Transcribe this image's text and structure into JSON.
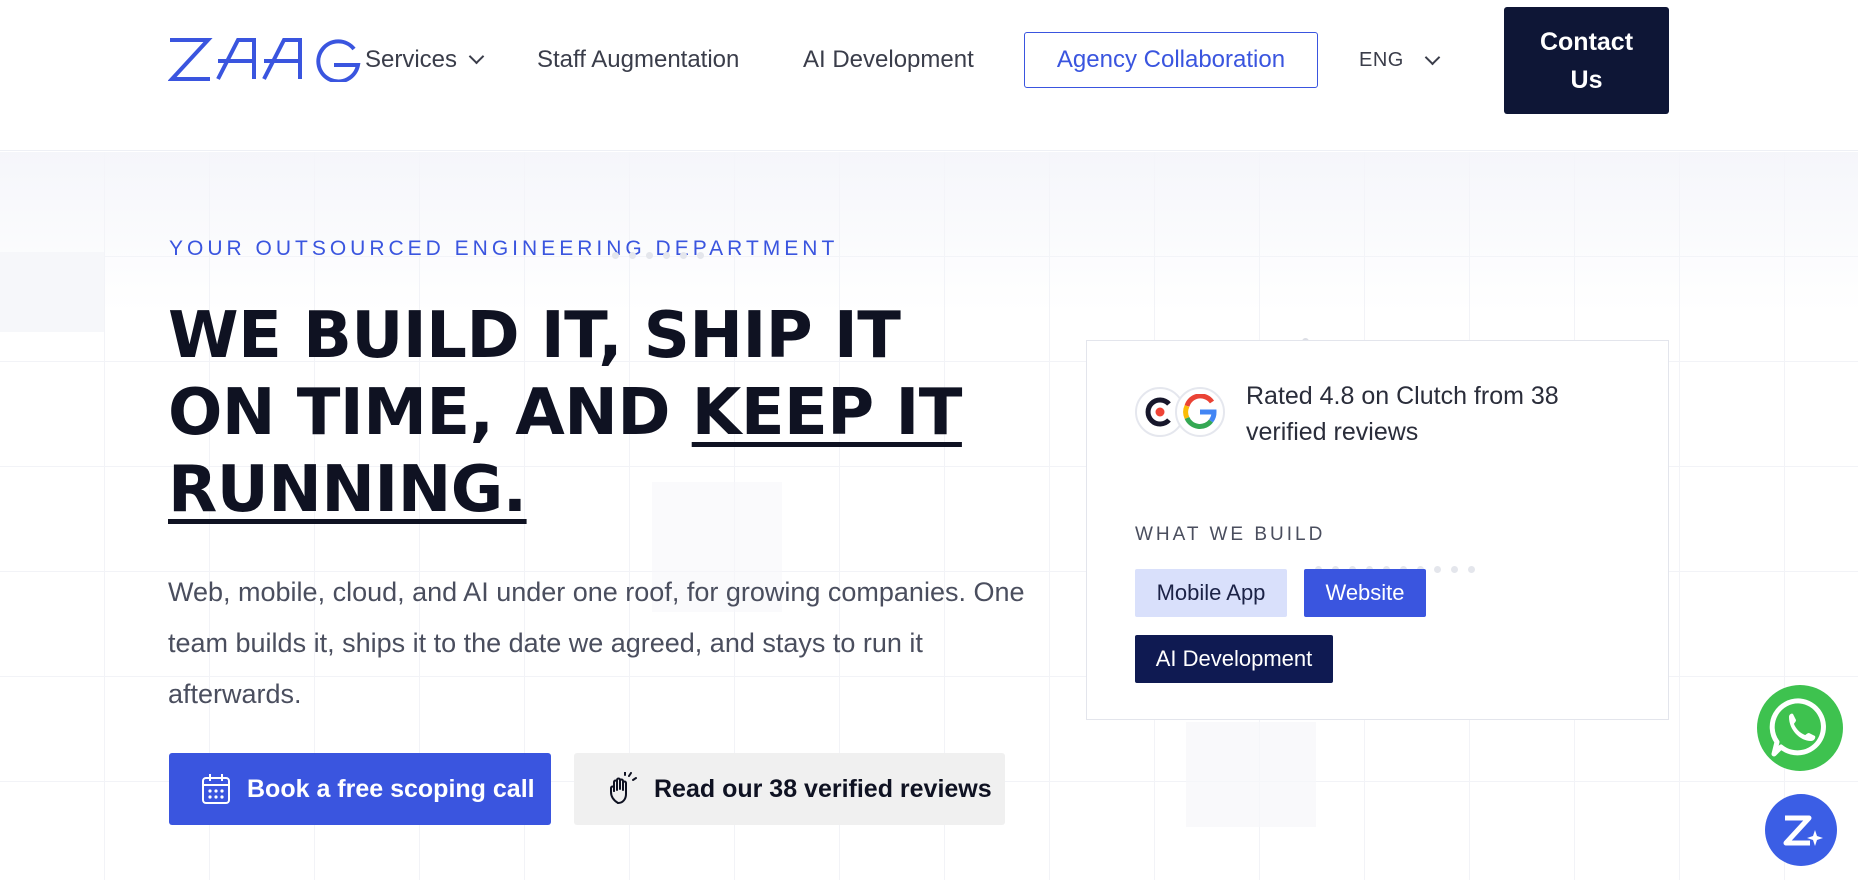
{
  "brand": {
    "logo_text": "ZAAG",
    "accent": "#3a55df",
    "dark": "#0e1636"
  },
  "header": {
    "nav": {
      "services": "Services",
      "staff": "Staff Augmentation",
      "ai": "AI Development",
      "agency": "Agency Collaboration"
    },
    "language": "ENG",
    "contact_label": "Contact Us"
  },
  "hero": {
    "eyebrow": "YOUR OUTSOURCED ENGINEERING DEPARTMENT",
    "headline_plain": "WE BUILD IT, SHIP IT ON TIME, AND ",
    "headline_underlined": "KEEP IT RUNNING.",
    "subtext": "Web, mobile, cloud, and AI under one roof, for growing companies. One team builds it, ships it to the date we agreed, and stays to run it afterwards.",
    "cta_primary": "Book a free scoping call",
    "cta_secondary": "Read our 38 verified reviews"
  },
  "card": {
    "rating_text": "Rated 4.8 on Clutch from 38 verified reviews",
    "section_title": "WHAT WE BUILD",
    "tags": [
      "Mobile App",
      "Website",
      "AI Development"
    ]
  },
  "icons": {
    "calendar": "calendar-icon",
    "hand": "hand-pointer-icon",
    "clutch": "clutch-logo-icon",
    "google": "google-logo-icon",
    "whatsapp": "whatsapp-icon",
    "chat": "zaag-chat-icon"
  }
}
